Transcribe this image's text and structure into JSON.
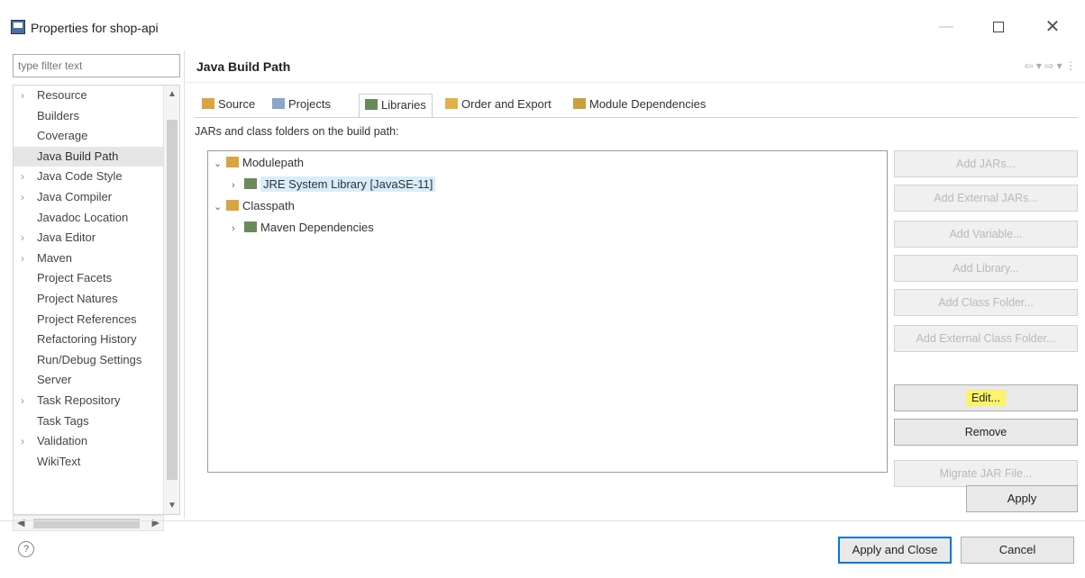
{
  "window": {
    "title": "Properties for shop-api",
    "minimize": "—",
    "close": "✕"
  },
  "left": {
    "filter_placeholder": "type filter text",
    "items": [
      {
        "label": "Resource",
        "expandable": true
      },
      {
        "label": "Builders",
        "expandable": false
      },
      {
        "label": "Coverage",
        "expandable": false
      },
      {
        "label": "Java Build Path",
        "expandable": false,
        "selected": true
      },
      {
        "label": "Java Code Style",
        "expandable": true
      },
      {
        "label": "Java Compiler",
        "expandable": true
      },
      {
        "label": "Javadoc Location",
        "expandable": false
      },
      {
        "label": "Java Editor",
        "expandable": true
      },
      {
        "label": "Maven",
        "expandable": true
      },
      {
        "label": "Project Facets",
        "expandable": false
      },
      {
        "label": "Project Natures",
        "expandable": false
      },
      {
        "label": "Project References",
        "expandable": false
      },
      {
        "label": "Refactoring History",
        "expandable": false
      },
      {
        "label": "Run/Debug Settings",
        "expandable": false
      },
      {
        "label": "Server",
        "expandable": false
      },
      {
        "label": "Task Repository",
        "expandable": true
      },
      {
        "label": "Task Tags",
        "expandable": false
      },
      {
        "label": "Validation",
        "expandable": true
      },
      {
        "label": "WikiText",
        "expandable": false
      }
    ]
  },
  "header": {
    "title": "Java Build Path",
    "nav": "⇦ ▾ ⇨ ▾ ⋮"
  },
  "tabs": [
    {
      "label": "Source",
      "icon_color": "#d9a441"
    },
    {
      "label": "Projects",
      "icon_color": "#8aa6c8"
    },
    {
      "label": "Libraries",
      "icon_color": "#6a8a5a",
      "active": true
    },
    {
      "label": "Order and Export",
      "icon_color": "#e2b04a"
    },
    {
      "label": "Module Dependencies",
      "icon_color": "#c8a040"
    }
  ],
  "main": {
    "subtitle": "JARs and class folders on the build path:",
    "tree": [
      {
        "label": "Modulepath",
        "expander": "⌄",
        "icon_color": "#d9a441"
      },
      {
        "label": "JRE System Library [JavaSE-11]",
        "expander": "›",
        "icon_color": "#6a8a5a",
        "highlighted": true
      },
      {
        "label": "Classpath",
        "expander": "⌄",
        "icon_color": "#d9a441"
      },
      {
        "label": "Maven Dependencies",
        "expander": "›",
        "icon_color": "#6a8a5a"
      }
    ],
    "buttons": [
      {
        "label": "Add JARs...",
        "enabled": false
      },
      {
        "label": "Add External JARs...",
        "enabled": false
      },
      {
        "label": "Add Variable...",
        "enabled": false
      },
      {
        "label": "Add Library...",
        "enabled": false
      },
      {
        "label": "Add Class Folder...",
        "enabled": false
      },
      {
        "label": "Add External Class Folder...",
        "enabled": false
      },
      {
        "label": "Edit...",
        "enabled": true,
        "highlight": true
      },
      {
        "label": "Remove",
        "enabled": true
      },
      {
        "label": "Migrate JAR File...",
        "enabled": false
      }
    ],
    "apply": "Apply"
  },
  "footer": {
    "help": "?",
    "apply_close": "Apply and Close",
    "cancel": "Cancel"
  }
}
